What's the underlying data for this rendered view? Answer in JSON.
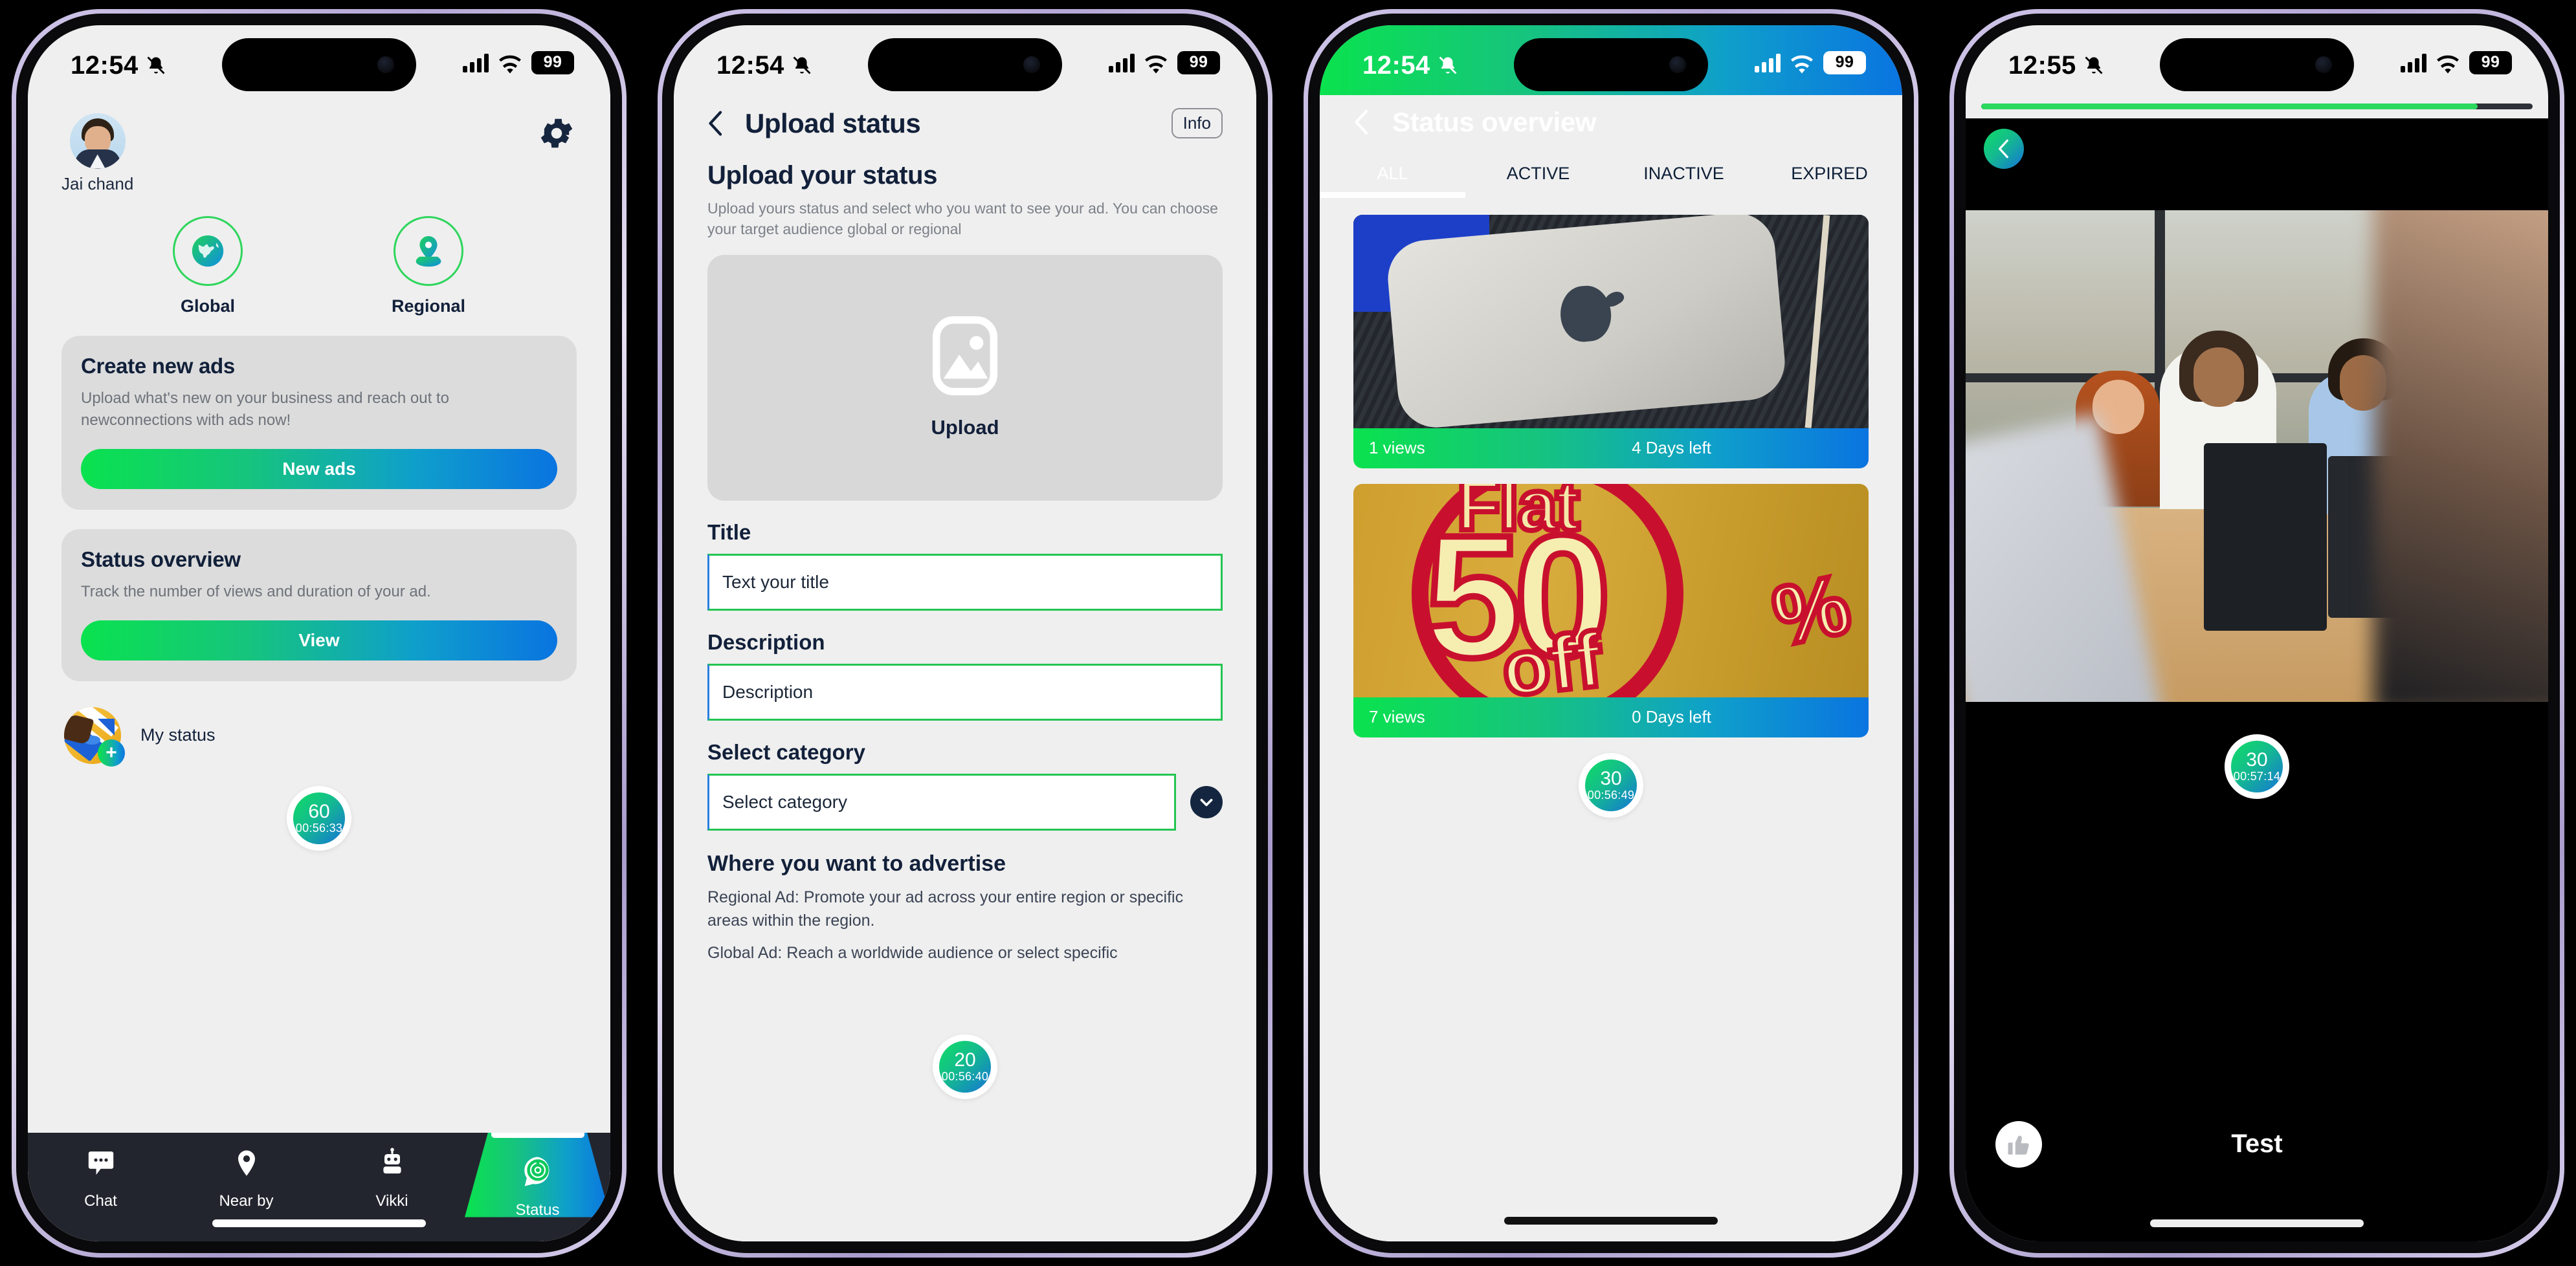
{
  "theme": {
    "accent_green": "#0ae24e",
    "accent_blue": "#0a74e0",
    "dark_nav": "#23252e",
    "page_bg": "#efefef",
    "card_bg": "#dcdcdc",
    "ink": "#12203a"
  },
  "phone1": {
    "status_bar": {
      "time": "12:54",
      "battery": "99",
      "icons": [
        "bell-off-icon",
        "cellular-icon",
        "wifi-icon",
        "battery-icon"
      ]
    },
    "user": {
      "name": "Jai chand"
    },
    "settings_icon": "gear-icon",
    "modes": [
      {
        "label": "Global",
        "icon": "globe-icon"
      },
      {
        "label": "Regional",
        "icon": "location-pin-icon"
      }
    ],
    "cards": [
      {
        "title": "Create new ads",
        "description": "Upload what's new on your business and reach out to newconnections with ads now!",
        "button": "New ads"
      },
      {
        "title": "Status overview",
        "description": "Track the number of views and duration of your ad.",
        "button": "View"
      }
    ],
    "my_status": {
      "label": "My status",
      "add_icon": "plus-icon"
    },
    "timer": {
      "count": "60",
      "time": "00:56:33"
    },
    "tabbar": [
      {
        "label": "Chat",
        "icon": "chat-bubble-icon",
        "active": false
      },
      {
        "label": "Near by",
        "icon": "location-pin-icon",
        "active": false
      },
      {
        "label": "Vikki",
        "icon": "robot-icon",
        "active": false
      },
      {
        "label": "Status",
        "icon": "status-swirl-icon",
        "active": true
      }
    ]
  },
  "phone2": {
    "status_bar": {
      "time": "12:54",
      "battery": "99"
    },
    "header": {
      "back_icon": "chevron-left-icon",
      "title": "Upload status",
      "info_button": "Info"
    },
    "section": {
      "heading": "Upload your status",
      "subtext": "Upload yours status and select who you want to see your ad. You can choose your target audience global or regional"
    },
    "upload": {
      "label": "Upload",
      "icon": "image-placeholder-icon"
    },
    "fields": [
      {
        "label": "Title",
        "value": "Text your title",
        "name": "title-input"
      },
      {
        "label": "Description",
        "value": "Description",
        "name": "description-input"
      },
      {
        "label": "Select category",
        "value": "Select category",
        "name": "category-select",
        "chevron": "chevron-down-icon"
      }
    ],
    "timer": {
      "count": "20",
      "time": "00:56:40"
    },
    "advertise": {
      "heading": "Where you want to advertise",
      "line1": "Regional Ad: Promote your ad across your entire region or specific areas within the region.",
      "line2": "Global Ad: Reach a worldwide audience or select specific"
    }
  },
  "phone3": {
    "status_bar": {
      "time": "12:54",
      "battery": "99"
    },
    "header": {
      "back_icon": "chevron-left-icon",
      "title": "Status overview"
    },
    "tabs": [
      {
        "label": "ALL",
        "active": true
      },
      {
        "label": "ACTIVE",
        "active": false
      },
      {
        "label": "INACTIVE",
        "active": false
      },
      {
        "label": "EXPIRED",
        "active": false
      }
    ],
    "cards": [
      {
        "image": "mac-mini-photo",
        "views": "1 views",
        "days": "4 Days left"
      },
      {
        "image": "flat-50-off-photo",
        "views": "7 views",
        "days": "0 Days left"
      }
    ],
    "timer": {
      "count": "30",
      "time": "00:56:49"
    }
  },
  "phone4": {
    "status_bar": {
      "time": "12:55",
      "battery": "99"
    },
    "progress_percent": 90,
    "back_icon": "chevron-left-icon",
    "image": "call-center-team-photo",
    "timer": {
      "count": "30",
      "time": "00:57:14"
    },
    "like_icon": "thumbs-up-icon",
    "caption": "Test"
  }
}
